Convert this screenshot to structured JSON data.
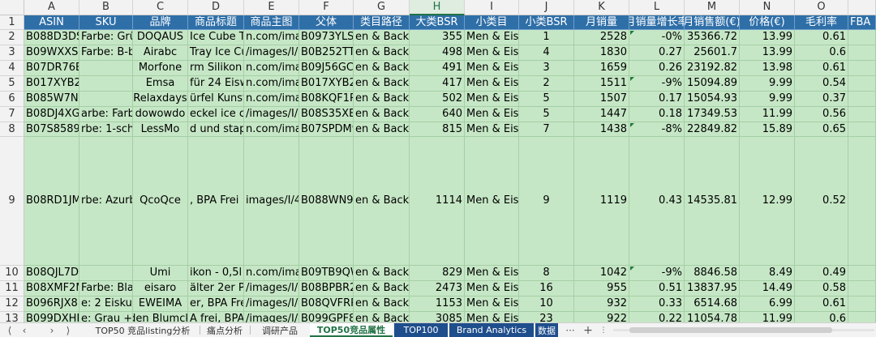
{
  "sheet": {
    "columns": [
      "A",
      "B",
      "C",
      "D",
      "E",
      "F",
      "G",
      "H",
      "I",
      "J",
      "K",
      "L",
      "M",
      "N",
      "O"
    ],
    "selected_column": "H",
    "row_numbers": [
      "1",
      "2",
      "3",
      "4",
      "5",
      "6",
      "7",
      "8",
      "9",
      "10",
      "11",
      "12",
      "13"
    ],
    "headers": [
      "ASIN",
      "SKU",
      "品牌",
      "商品标题",
      "商品主图",
      "父体",
      "类目路径",
      "大类BSR",
      "小类目",
      "小类BSR",
      "月销量",
      "月销量增长率",
      "月销售额(€)",
      "价格(€)",
      "毛利率",
      "FBA"
    ],
    "rows": [
      [
        "B088D3DSYF",
        "Farbe: Grün",
        "DOQAUS",
        "Ice Cube Tray",
        "n.com/images",
        "B0973YLS3Q",
        "en & Backe",
        "355",
        "Men & Eisw",
        "1",
        "2528",
        "-0%",
        "35366.72",
        "13.99",
        "0.61"
      ],
      [
        "B09WXXS2F",
        "Farbe: B-black",
        "Airabc",
        "Tray Ice Cu",
        "/images/I/3",
        "B0B252TT8Q",
        "en & Backe",
        "498",
        "Men & Eisw",
        "4",
        "1830",
        "0.27",
        "25601.7",
        "13.99",
        "0.6"
      ],
      [
        "B07DR76BZ",
        "",
        "Morfone",
        "rm Silikon",
        "n.com/images",
        "B09J56GCF2",
        "en & Backe",
        "491",
        "Men & Eisw",
        "3",
        "1659",
        "0.26",
        "23192.82",
        "13.98",
        "0.61"
      ],
      [
        "B017XYB27I",
        "",
        "Emsa",
        "für 24 Eisw",
        "n.com/images",
        "B017XYB27I",
        "en & Backe",
        "417",
        "Men & Eisw",
        "2",
        "1511",
        "-9%",
        "15094.89",
        "9.99",
        "0.54"
      ],
      [
        "B085W7N3T",
        "",
        "Relaxdays",
        "ürfel Kunst",
        "n.com/images",
        "B08KQF1R9Q",
        "en & Backe",
        "502",
        "Men & Eisw",
        "5",
        "1507",
        "0.17",
        "15054.93",
        "9.99",
        "0.37"
      ],
      [
        "B08DJ4XGD",
        "arbe: Farbig",
        "dowowdo",
        "eckel ice cu",
        "/images/I/4",
        "B08S35XBQ",
        "en & Backe",
        "640",
        "Men & Eisw",
        "5",
        "1447",
        "0.18",
        "17349.53",
        "11.99",
        "0.56"
      ],
      [
        "B07S8589X",
        "rbe: 1-schw",
        "LessMo",
        "d und stap",
        "n.com/images",
        "B07SPDM9Z",
        "en & Backe",
        "815",
        "Men & Eisw",
        "7",
        "1438",
        "-8%",
        "22849.82",
        "15.89",
        "0.65"
      ],
      [
        "B08RD1JMW",
        "rbe: Azurbl",
        "QcoQce",
        ", BPA Frei",
        "images/I/4",
        "B088WN9Q",
        "en & Backe",
        "1114",
        "Men & Eisw",
        "9",
        "1119",
        "0.43",
        "14535.81",
        "12.99",
        "0.52"
      ],
      [
        "B08QJL7DR",
        "",
        "Umi",
        "ikon - 0,5l",
        "n.com/images",
        "B09TB9QW5",
        "en & Backe",
        "829",
        "Men & Eisw",
        "8",
        "1042",
        "-9%",
        "8846.58",
        "8.49",
        "0.49"
      ],
      [
        "B08XMF2MF",
        "Farbe: Blau",
        "eisaro",
        "älter 2er P",
        "/images/I/3",
        "B08BPBR28",
        "en & Backe",
        "2473",
        "Men & Eisw",
        "16",
        "955",
        "0.51",
        "13837.95",
        "14.49",
        "0.58"
      ],
      [
        "B096RJX8M",
        "e: 2 Eiskuge",
        "EWEIMA",
        "er, BPA Frei",
        "/images/I/4",
        "B08QVFRRM",
        "en & Backe",
        "1153",
        "Men & Eisw",
        "10",
        "932",
        "0.33",
        "6514.68",
        "6.99",
        "0.61"
      ],
      [
        "B099DXHFQ",
        "e: Grau + C",
        "den Blumck",
        "A frei, BPA f",
        "/images/I/4",
        "B099GPF8H",
        "en & Backe",
        "3085",
        "Men & Eisw",
        "23",
        "922",
        "0.22",
        "11054.78",
        "11.99",
        "0.6"
      ]
    ]
  },
  "tabbar": {
    "nav_icons": [
      "first-sheet-icon",
      "prev-sheet-icon",
      "next-sheet-icon",
      "last-sheet-icon"
    ],
    "tabs": [
      "TOP50 竞品listing分析",
      "痛点分析",
      "调研产品",
      "TOP50竞品属性",
      "TOP100",
      "Brand Analytics",
      "数据"
    ],
    "active_tab": "TOP50竞品属性",
    "more": "···",
    "add": "+"
  },
  "colors": {
    "data_fill": "#c6e7c6",
    "header_fill": "#2f6fa8",
    "header_text": "#ffffff",
    "tab_blue": "#1f4e8c",
    "accent_green": "#217346"
  }
}
